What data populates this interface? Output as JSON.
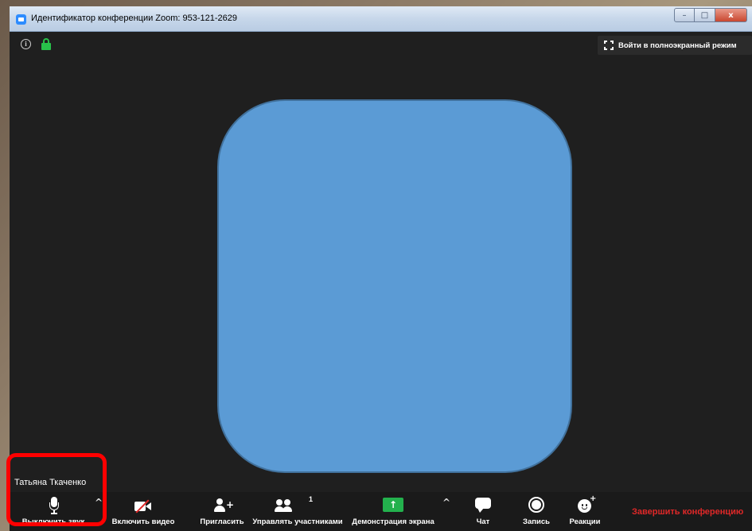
{
  "window": {
    "title": "Идентификатор конференции Zoom: 953-121-2629",
    "controls": {
      "minimize": "–",
      "maximize": "□",
      "close": "x"
    }
  },
  "meeting": {
    "info_icon": "info-icon",
    "lock_icon": "lock-icon",
    "fullscreen_label": "Войти в полноэкранный режим",
    "participant_name": "Татьяна Ткаченко",
    "tile_color": "#5b9bd5"
  },
  "toolbar": {
    "mute_label": "Выключить звук",
    "video_label": "Включить видео",
    "invite_label": "Пригласить",
    "participants_label": "Управлять участниками",
    "participants_count": "1",
    "share_label": "Демонстрация экрана",
    "share_arrow": "↑",
    "chat_label": "Чат",
    "record_label": "Запись",
    "reactions_label": "Реакции",
    "end_label": "Завершить конференцию",
    "caret": "^",
    "end_color": "#e02828",
    "share_color": "#23b14d"
  },
  "annotation": {
    "highlight_color": "#ff0000"
  }
}
